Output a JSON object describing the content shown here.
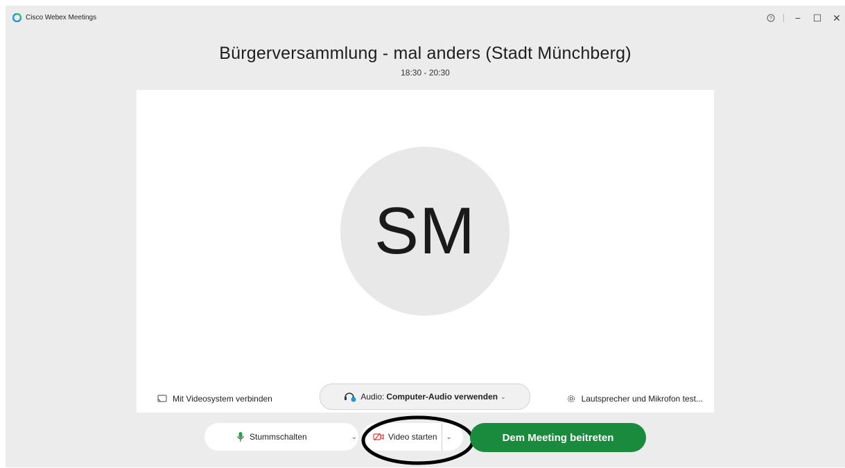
{
  "app": {
    "title": "Cisco Webex Meetings",
    "accent_color": "#1a8a3d"
  },
  "window_controls": {
    "help_icon": "help-circle-icon",
    "minimize_label": "−",
    "maximize_label": "☐",
    "close_label": "✕"
  },
  "meeting": {
    "title": "Bürgerversammlung - mal anders (Stadt Münchberg)",
    "time": "18:30 - 20:30"
  },
  "preview": {
    "avatar_initials": "SM",
    "video_system_label": "Mit Videosystem verbinden",
    "audio_prefix": "Audio:",
    "audio_value": "Computer-Audio verwenden",
    "speaker_test_label": "Lautsprecher und Mikrofon test..."
  },
  "controls": {
    "mute_label": "Stummschalten",
    "video_label": "Video starten",
    "join_label": "Dem Meeting beitreten"
  }
}
